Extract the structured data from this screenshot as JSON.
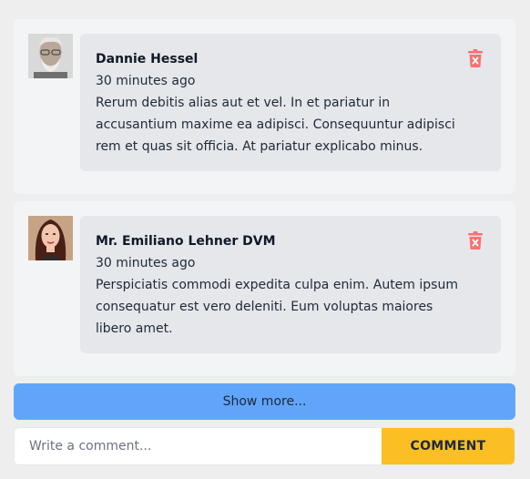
{
  "comments": [
    {
      "author": "Dannie Hessel",
      "time": "30 minutes ago",
      "body": "Rerum debitis alias aut et vel. In et pariatur in accusantium maxime ea adipisci. Consequuntur adipisci rem et quas sit officia. At pariatur explicabo minus.",
      "avatar": "avatar-older-man-photo"
    },
    {
      "author": "Mr. Emiliano Lehner DVM",
      "time": "30 minutes ago",
      "body": "Perspiciatis commodi expedita culpa enim. Autem ipsum consequatur est vero deleniti. Eum voluptas maiores libero amet.",
      "avatar": "avatar-woman-photo"
    }
  ],
  "show_more_label": "Show more...",
  "composer": {
    "placeholder": "Write a comment...",
    "value": "",
    "submit_label": "COMMENT"
  },
  "colors": {
    "card_bg": "#f3f4f6",
    "bubble_bg": "#e5e7eb",
    "show_more_bg": "#60a5fa",
    "submit_bg": "#fbbf24",
    "delete_icon": "#f87171"
  },
  "icons": {
    "delete": "trash-x-icon"
  }
}
